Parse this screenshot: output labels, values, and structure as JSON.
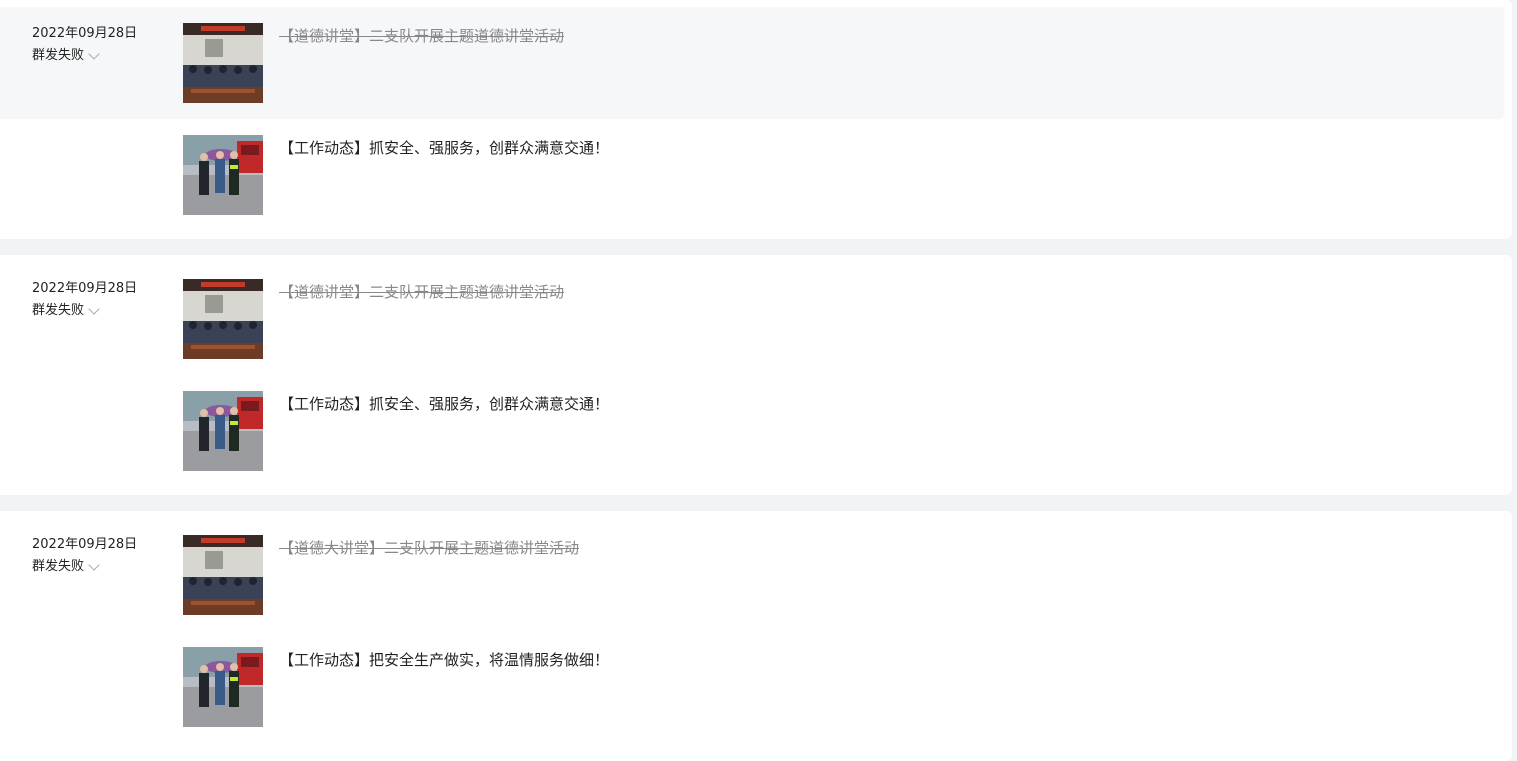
{
  "groups": [
    {
      "date": "2022年09月28日",
      "status": "群发失败",
      "articles": [
        {
          "title": "【道德讲堂】二支队开展主题道德讲堂活动",
          "deleted": true,
          "thumb": "meeting"
        },
        {
          "title": "【工作动态】抓安全、强服务，创群众满意交通！",
          "deleted": false,
          "thumb": "road"
        }
      ]
    },
    {
      "date": "2022年09月28日",
      "status": "群发失败",
      "articles": [
        {
          "title": "【道德讲堂】二支队开展主题道德讲堂活动",
          "deleted": true,
          "thumb": "meeting"
        },
        {
          "title": "【工作动态】抓安全、强服务，创群众满意交通！",
          "deleted": false,
          "thumb": "road"
        }
      ]
    },
    {
      "date": "2022年09月28日",
      "status": "群发失败",
      "articles": [
        {
          "title": "【道德大讲堂】二支队开展主题道德讲堂活动",
          "deleted": true,
          "thumb": "meeting"
        },
        {
          "title": "【工作动态】把安全生产做实，将温情服务做细！",
          "deleted": false,
          "thumb": "road"
        }
      ]
    }
  ]
}
